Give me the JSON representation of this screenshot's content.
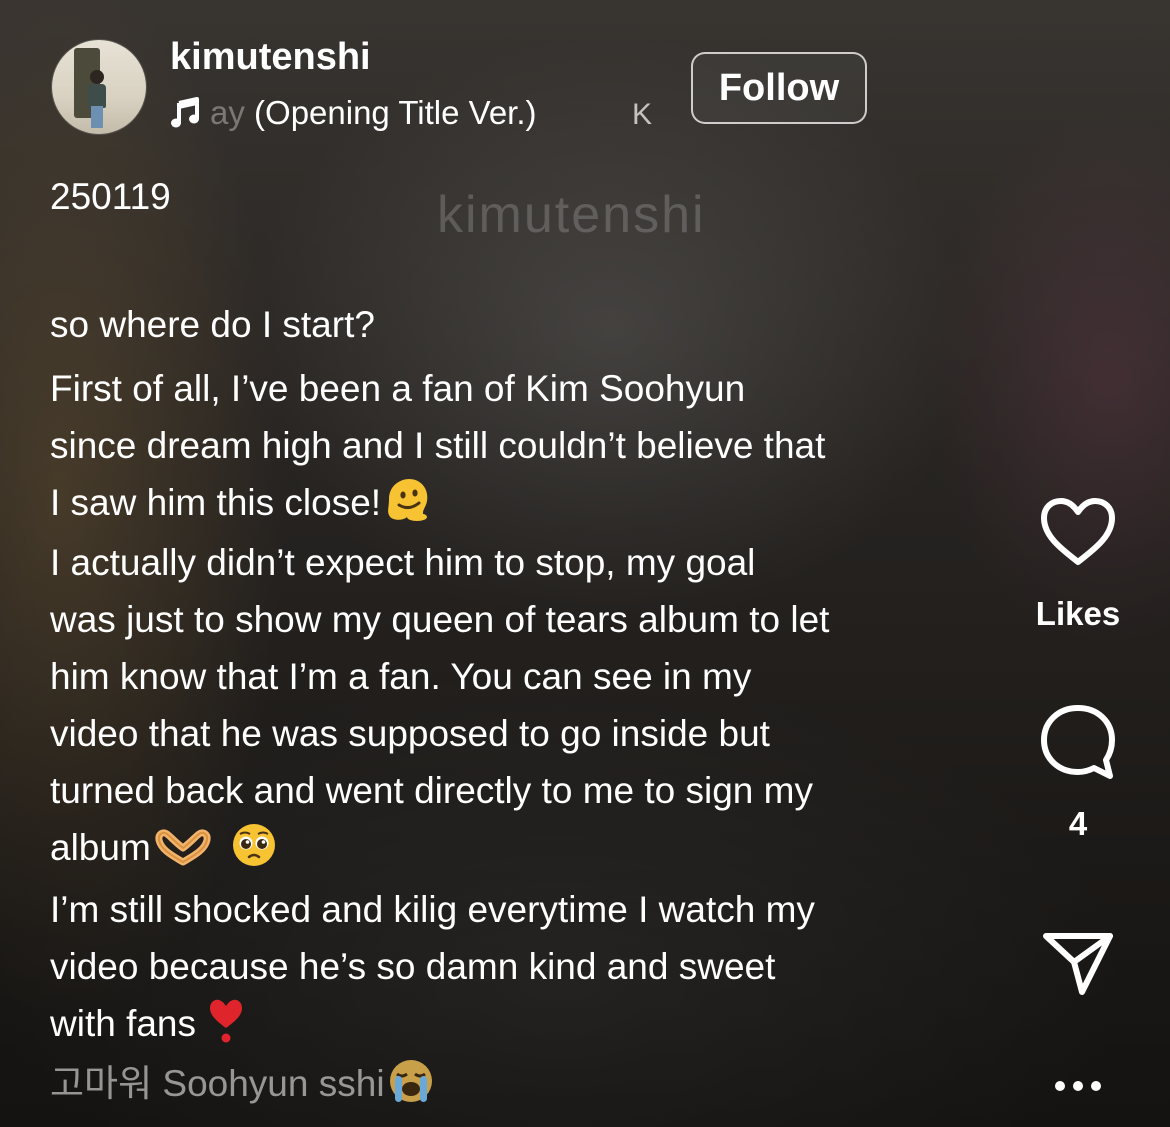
{
  "post": {
    "username": "kimutenshi",
    "follow_label": "Follow",
    "music": {
      "track_visible": "(Opening Title Ver.)",
      "track_faded_prefix": "ay",
      "next_letter": "K"
    },
    "watermark": "kimutenshi"
  },
  "caption": {
    "date_line": "250119",
    "lines": [
      "so where do I start?",
      "First of all, I’ve been a fan of Kim Soohyun",
      "since dream high and I still couldn’t believe that",
      "I saw him this close!",
      "I actually didn’t expect him to stop, my goal",
      "was just to show my queen of tears album to let",
      "him know that I’m a fan. You can see in my",
      "video that he was supposed to go inside but",
      "turned back and went directly to me to sign my",
      "album",
      "I’m still shocked and kilig everytime I watch my",
      "video because he’s so damn kind and sweet",
      "with fans",
      "고마워 Soohyun sshi"
    ]
  },
  "actions": {
    "likes_label": "Likes",
    "comments_count": "4"
  },
  "icons": {
    "music": "music-note-icon",
    "like": "heart-icon",
    "comment": "comment-bubble-icon",
    "share": "send-icon",
    "more": "more-dots-icon",
    "emoji_melting": "melting-face-emoji",
    "emoji_heart_hands": "heart-hands-emoji",
    "emoji_pleading": "pleading-face-emoji",
    "emoji_heart": "red-heart-exclamation-emoji",
    "emoji_crying": "loudly-crying-face-emoji"
  },
  "colors": {
    "text": "#ffffff",
    "faded_text": "#8c8986",
    "emoji_yellow": "#f7c332",
    "heart_red": "#e0242c"
  }
}
